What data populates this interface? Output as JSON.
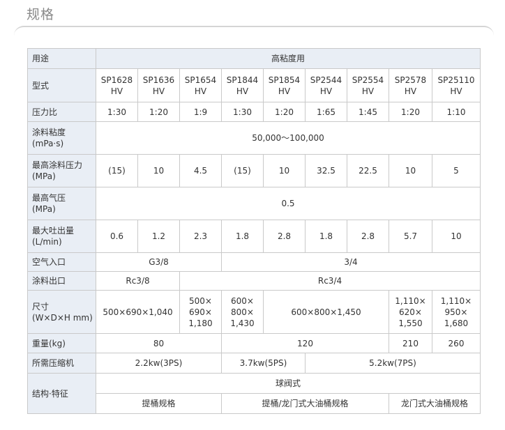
{
  "page": {
    "title": "规格"
  },
  "table": {
    "usage_label": "用途",
    "usage_value": "高粘度用",
    "model_label": "型式",
    "models": [
      "SP1628\nHV",
      "SP1636\nHV",
      "SP1654\nHV",
      "SP1844\nHV",
      "SP1854\nHV",
      "SP2544\nHV",
      "SP2554\nHV",
      "SP2578\nHV",
      "SP25110\nHV"
    ],
    "ratio_label": "压力比",
    "ratios": [
      "1:30",
      "1:20",
      "1:9",
      "1:30",
      "1:20",
      "1:65",
      "1:45",
      "1:20",
      "1:10"
    ],
    "viscosity_label": "涂料粘度\n(mPa·s)",
    "viscosity_value": "50,000～100,000",
    "max_fluid_pressure_label": "最高涂料压力\n(MPa)",
    "max_fluid_pressures": [
      "(15)",
      "10",
      "4.5",
      "(15)",
      "10",
      "32.5",
      "22.5",
      "10",
      "5"
    ],
    "max_air_pressure_label": "最高气压\n(MPa)",
    "max_air_pressure_value": "0.5",
    "max_output_label": "最大吐出量\n(L/min)",
    "max_outputs": [
      "0.6",
      "1.2",
      "2.3",
      "1.8",
      "2.8",
      "1.8",
      "2.8",
      "5.7",
      "10"
    ],
    "air_inlet_label": "空气入口",
    "air_inlet_a": "G3/8",
    "air_inlet_b": "3/4",
    "fluid_outlet_label": "涂料出口",
    "fluid_outlet_a": "Rc3/8",
    "fluid_outlet_b": "Rc3/4",
    "dimensions_label": "尺寸\n(W×D×H mm)",
    "dim_1": "500×690×1,040",
    "dim_2": "500×\n690×\n1,180",
    "dim_3": "600×\n800×\n1,430",
    "dim_4": "600×800×1,450",
    "dim_5": "1,110×\n620×\n1,550",
    "dim_6": "1,110×\n950×\n1,680",
    "weight_label": "重量(kg)",
    "weight_1": "80",
    "weight_2": "120",
    "weight_3": "210",
    "weight_4": "260",
    "compressor_label": "所需压缩机",
    "compressor_1": "2.2kw(3PS)",
    "compressor_2": "3.7kw(5PS)",
    "compressor_3": "5.2kw(7PS)",
    "structure_label": "结构·特征",
    "structure_top": "球阀式",
    "structure_1": "提桶规格",
    "structure_2": "提桶/龙门式大油桶规格",
    "structure_3": "龙门式大油桶规格"
  }
}
